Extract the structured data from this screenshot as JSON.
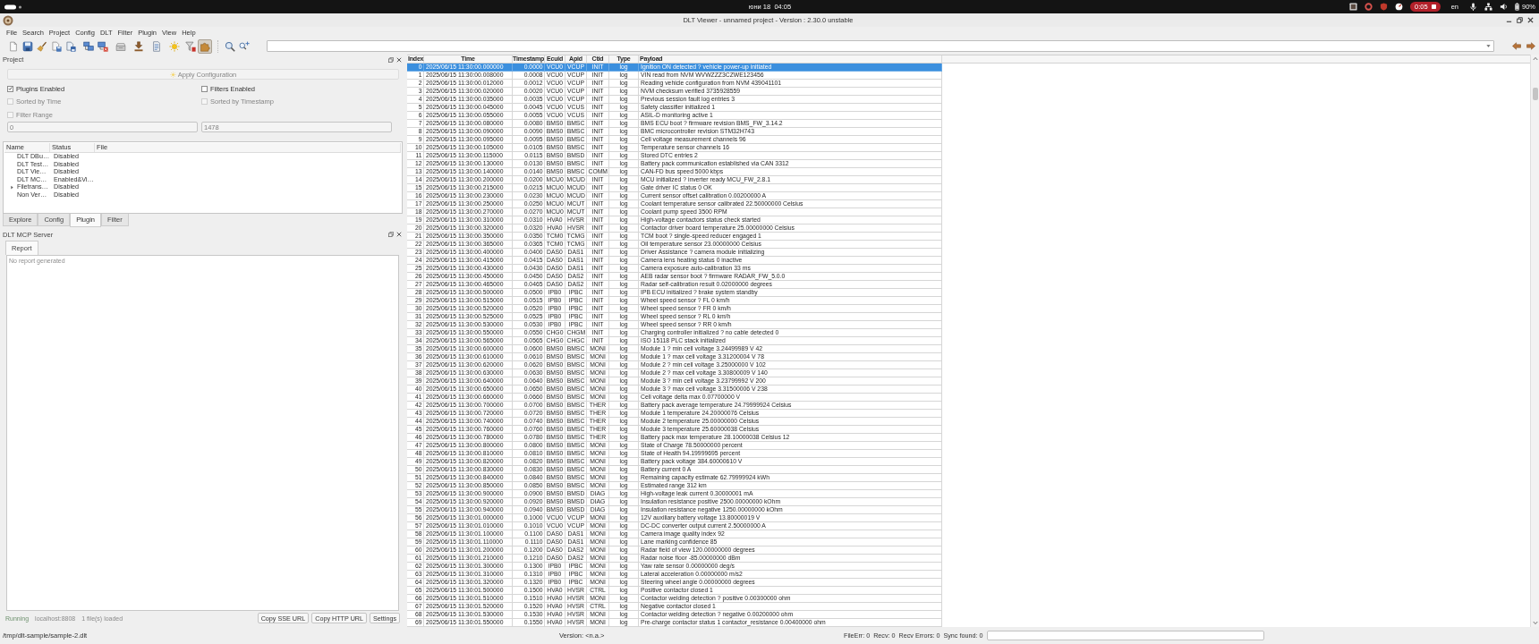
{
  "top_bar": {
    "clock": "юни 18  04:05",
    "recording_time": "0:05",
    "keyboard_layout": "en",
    "battery": "90%"
  },
  "window": {
    "title": "DLT Viewer - unnamed project - Version : 2.30.0 unstable"
  },
  "menu": [
    "File",
    "Search",
    "Project",
    "Config",
    "DLT",
    "Filter",
    "Plugin",
    "View",
    "Help"
  ],
  "toolbar": {
    "buttons": [
      {
        "pressed": false
      },
      {
        "pressed": false
      },
      {
        "pressed": false
      },
      {
        "pressed": false
      },
      {
        "pressed": false
      },
      {
        "pressed": false
      },
      {
        "pressed": false
      },
      {
        "pressed": false
      },
      {
        "pressed": false
      },
      {
        "pressed": false
      },
      {
        "pressed": false
      },
      {
        "pressed": false
      },
      {
        "pressed": true
      },
      {
        "pressed": false
      },
      {
        "pressed": false
      }
    ]
  },
  "project_panel": {
    "title": "Project",
    "apply_button": {
      "label": "Apply Configuration",
      "disabled": true
    },
    "options": [
      {
        "label": "Plugins Enabled",
        "checked": true,
        "disabled": false
      },
      {
        "label": "Filters Enabled",
        "checked": false,
        "disabled": false
      },
      {
        "label": "Sorted by Time",
        "checked": false,
        "disabled": true
      },
      {
        "label": "Sorted by Timestamp",
        "checked": false,
        "disabled": true
      },
      {
        "label": "Filter Range",
        "checked": false,
        "disabled": true
      }
    ],
    "range": [
      {
        "value": "0",
        "disabled": true
      },
      {
        "value": "1478",
        "disabled": true
      }
    ],
    "plugins": {
      "columns": [
        "Name",
        "Status",
        "File"
      ],
      "rows": [
        {
          "name": "DLT DBu…",
          "status": "Disabled",
          "has_children": false
        },
        {
          "name": "DLT Test…",
          "status": "Disabled",
          "has_children": false
        },
        {
          "name": "DLT Vie…",
          "status": "Disabled",
          "has_children": false
        },
        {
          "name": "DLT MC…",
          "status": "Enabled&Vi…",
          "has_children": false
        },
        {
          "name": "Filetrans…",
          "status": "Disabled",
          "has_children": true
        },
        {
          "name": "Non Ver…",
          "status": "Disabled",
          "has_children": false
        }
      ]
    },
    "tabs": [
      {
        "label": "Explore",
        "selected": false
      },
      {
        "label": "Config",
        "selected": false
      },
      {
        "label": "Plugin",
        "selected": true
      },
      {
        "label": "Filter",
        "selected": false
      }
    ]
  },
  "mcp_panel": {
    "title": "DLT MCP Server",
    "tabs": [
      {
        "label": "Report",
        "selected": true
      }
    ],
    "report": {
      "placeholder": "No report generated"
    },
    "state": "Running",
    "address": "localhost:8808",
    "files": "1 file(s) loaded",
    "buttons": [
      "Copy SSE URL",
      "Copy HTTP URL",
      "Settings"
    ]
  },
  "log_table": {
    "columns": [
      "Index",
      "Time",
      "Timestamp",
      "Ecuid",
      "Apid",
      "Ctid",
      "Type",
      "Payload"
    ],
    "rows": [
      {
        "selected": true,
        "cells": [
          "0",
          "2025/06/15 11:30:00.000000",
          "0.0000",
          "VCU0",
          "VCUP",
          "INIT",
          "log",
          "Ignition ON detected ? vehicle power-up initiated"
        ]
      },
      {
        "selected": false,
        "cells": [
          "1",
          "2025/06/15 11:30:00.008000",
          "0.0008",
          "VCU0",
          "VCUP",
          "INIT",
          "log",
          "VIN read from NVM WVWZZZ3CZWE123456"
        ]
      },
      {
        "selected": false,
        "cells": [
          "2",
          "2025/06/15 11:30:00.012000",
          "0.0012",
          "VCU0",
          "VCUP",
          "INIT",
          "log",
          "Reading vehicle configuration from NVM 439041101"
        ]
      },
      {
        "selected": false,
        "cells": [
          "3",
          "2025/06/15 11:30:00.020000",
          "0.0020",
          "VCU0",
          "VCUP",
          "INIT",
          "log",
          "NVM checksum verified 3735928559"
        ]
      },
      {
        "selected": false,
        "cells": [
          "4",
          "2025/06/15 11:30:00.035000",
          "0.0035",
          "VCU0",
          "VCUP",
          "INIT",
          "log",
          "Previous session fault log entries 3"
        ]
      },
      {
        "selected": false,
        "cells": [
          "5",
          "2025/06/15 11:30:00.045000",
          "0.0045",
          "VCU0",
          "VCUS",
          "INIT",
          "log",
          "Safety classifier initialized 1"
        ]
      },
      {
        "selected": false,
        "cells": [
          "6",
          "2025/06/15 11:30:00.055000",
          "0.0055",
          "VCU0",
          "VCUS",
          "INIT",
          "log",
          "ASIL-D monitoring active 1"
        ]
      },
      {
        "selected": false,
        "cells": [
          "7",
          "2025/06/15 11:30:00.080000",
          "0.0080",
          "BMS0",
          "BMSC",
          "INIT",
          "log",
          "BMS ECU boot ? firmware revision BMS_FW_3.14.2"
        ]
      },
      {
        "selected": false,
        "cells": [
          "8",
          "2025/06/15 11:30:00.090000",
          "0.0090",
          "BMS0",
          "BMSC",
          "INIT",
          "log",
          "BMC microcontroller revision STM32H743"
        ]
      },
      {
        "selected": false,
        "cells": [
          "9",
          "2025/06/15 11:30:00.095000",
          "0.0095",
          "BMS0",
          "BMSC",
          "INIT",
          "log",
          "Cell voltage measurement channels 96"
        ]
      },
      {
        "selected": false,
        "cells": [
          "10",
          "2025/06/15 11:30:00.105000",
          "0.0105",
          "BMS0",
          "BMSC",
          "INIT",
          "log",
          "Temperature sensor channels 16"
        ]
      },
      {
        "selected": false,
        "cells": [
          "11",
          "2025/06/15 11:30:00.115000",
          "0.0115",
          "BMS0",
          "BMSD",
          "INIT",
          "log",
          "Stored DTC entries 2"
        ]
      },
      {
        "selected": false,
        "cells": [
          "12",
          "2025/06/15 11:30:00.130000",
          "0.0130",
          "BMS0",
          "BMSC",
          "INIT",
          "log",
          "Battery pack communication established via CAN 3312"
        ]
      },
      {
        "selected": false,
        "cells": [
          "13",
          "2025/06/15 11:30:00.140000",
          "0.0140",
          "BMS0",
          "BMSC",
          "COMM",
          "log",
          "CAN-FD bus speed 5000 kbps"
        ]
      },
      {
        "selected": false,
        "cells": [
          "14",
          "2025/06/15 11:30:00.200000",
          "0.0200",
          "MCU0",
          "MCUD",
          "INIT",
          "log",
          "MCU initialized ? inverter ready MCU_FW_2.8.1"
        ]
      },
      {
        "selected": false,
        "cells": [
          "15",
          "2025/06/15 11:30:00.215000",
          "0.0215",
          "MCU0",
          "MCUD",
          "INIT",
          "log",
          "Gate driver IC status 0 OK"
        ]
      },
      {
        "selected": false,
        "cells": [
          "16",
          "2025/06/15 11:30:00.230000",
          "0.0230",
          "MCU0",
          "MCUD",
          "INIT",
          "log",
          "Current sensor offset calibration 0.00200000 A"
        ]
      },
      {
        "selected": false,
        "cells": [
          "17",
          "2025/06/15 11:30:00.250000",
          "0.0250",
          "MCU0",
          "MCUT",
          "INIT",
          "log",
          "Coolant temperature sensor calibrated 22.50000000 Celsius"
        ]
      },
      {
        "selected": false,
        "cells": [
          "18",
          "2025/06/15 11:30:00.270000",
          "0.0270",
          "MCU0",
          "MCUT",
          "INIT",
          "log",
          "Coolant pump speed 3500 RPM"
        ]
      },
      {
        "selected": false,
        "cells": [
          "19",
          "2025/06/15 11:30:00.310000",
          "0.0310",
          "HVA0",
          "HVSR",
          "INIT",
          "log",
          "High-voltage contactors status check started"
        ]
      },
      {
        "selected": false,
        "cells": [
          "20",
          "2025/06/15 11:30:00.320000",
          "0.0320",
          "HVA0",
          "HVSR",
          "INIT",
          "log",
          "Contactor driver board temperature 25.00000000 Celsius"
        ]
      },
      {
        "selected": false,
        "cells": [
          "21",
          "2025/06/15 11:30:00.350000",
          "0.0350",
          "TCM0",
          "TCMG",
          "INIT",
          "log",
          "TCM boot ? single-speed reducer engaged 1"
        ]
      },
      {
        "selected": false,
        "cells": [
          "22",
          "2025/06/15 11:30:00.365000",
          "0.0365",
          "TCM0",
          "TCMG",
          "INIT",
          "log",
          "Oil temperature sensor 23.00000000 Celsius"
        ]
      },
      {
        "selected": false,
        "cells": [
          "23",
          "2025/06/15 11:30:00.400000",
          "0.0400",
          "DAS0",
          "DAS1",
          "INIT",
          "log",
          "Driver Assistance ? camera module initializing"
        ]
      },
      {
        "selected": false,
        "cells": [
          "24",
          "2025/06/15 11:30:00.415000",
          "0.0415",
          "DAS0",
          "DAS1",
          "INIT",
          "log",
          "Camera lens heating status 0 inactive"
        ]
      },
      {
        "selected": false,
        "cells": [
          "25",
          "2025/06/15 11:30:00.430000",
          "0.0430",
          "DAS0",
          "DAS1",
          "INIT",
          "log",
          "Camera exposure auto-calibration 33 ms"
        ]
      },
      {
        "selected": false,
        "cells": [
          "26",
          "2025/06/15 11:30:00.450000",
          "0.0450",
          "DAS0",
          "DAS2",
          "INIT",
          "log",
          "AEB radar sensor boot ? firmware RADAR_FW_5.0.0"
        ]
      },
      {
        "selected": false,
        "cells": [
          "27",
          "2025/06/15 11:30:00.465000",
          "0.0465",
          "DAS0",
          "DAS2",
          "INIT",
          "log",
          "Radar self-calibration result 0.02000000 degrees"
        ]
      },
      {
        "selected": false,
        "cells": [
          "28",
          "2025/06/15 11:30:00.500000",
          "0.0500",
          "IPB0",
          "IPBC",
          "INIT",
          "log",
          "IPB ECU initialized ? brake system standby"
        ]
      },
      {
        "selected": false,
        "cells": [
          "29",
          "2025/06/15 11:30:00.515000",
          "0.0515",
          "IPB0",
          "IPBC",
          "INIT",
          "log",
          "Wheel speed sensor ? FL 0 km/h"
        ]
      },
      {
        "selected": false,
        "cells": [
          "30",
          "2025/06/15 11:30:00.520000",
          "0.0520",
          "IPB0",
          "IPBC",
          "INIT",
          "log",
          "Wheel speed sensor ? FR 0 km/h"
        ]
      },
      {
        "selected": false,
        "cells": [
          "31",
          "2025/06/15 11:30:00.525000",
          "0.0525",
          "IPB0",
          "IPBC",
          "INIT",
          "log",
          "Wheel speed sensor ? RL 0 km/h"
        ]
      },
      {
        "selected": false,
        "cells": [
          "32",
          "2025/06/15 11:30:00.530000",
          "0.0530",
          "IPB0",
          "IPBC",
          "INIT",
          "log",
          "Wheel speed sensor ? RR 0 km/h"
        ]
      },
      {
        "selected": false,
        "cells": [
          "33",
          "2025/06/15 11:30:00.550000",
          "0.0550",
          "CHG0",
          "CHGM",
          "INIT",
          "log",
          "Charging controller initialized ? no cable detected 0"
        ]
      },
      {
        "selected": false,
        "cells": [
          "34",
          "2025/06/15 11:30:00.565000",
          "0.0565",
          "CHG0",
          "CHGC",
          "INIT",
          "log",
          "ISO 15118 PLC stack initialized"
        ]
      },
      {
        "selected": false,
        "cells": [
          "35",
          "2025/06/15 11:30:00.600000",
          "0.0600",
          "BMS0",
          "BMSC",
          "MONI",
          "log",
          "Module 1 ? min cell voltage 3.24499989 V 42"
        ]
      },
      {
        "selected": false,
        "cells": [
          "36",
          "2025/06/15 11:30:00.610000",
          "0.0610",
          "BMS0",
          "BMSC",
          "MONI",
          "log",
          "Module 1 ? max cell voltage 3.31200004 V 78"
        ]
      },
      {
        "selected": false,
        "cells": [
          "37",
          "2025/06/15 11:30:00.620000",
          "0.0620",
          "BMS0",
          "BMSC",
          "MONI",
          "log",
          "Module 2 ? min cell voltage 3.25000000 V 102"
        ]
      },
      {
        "selected": false,
        "cells": [
          "38",
          "2025/06/15 11:30:00.630000",
          "0.0630",
          "BMS0",
          "BMSC",
          "MONI",
          "log",
          "Module 2 ? max cell voltage 3.30800009 V 140"
        ]
      },
      {
        "selected": false,
        "cells": [
          "39",
          "2025/06/15 11:30:00.640000",
          "0.0640",
          "BMS0",
          "BMSC",
          "MONI",
          "log",
          "Module 3 ? min cell voltage 3.23799992 V 200"
        ]
      },
      {
        "selected": false,
        "cells": [
          "40",
          "2025/06/15 11:30:00.650000",
          "0.0650",
          "BMS0",
          "BMSC",
          "MONI",
          "log",
          "Module 3 ? max cell voltage 3.31500006 V 238"
        ]
      },
      {
        "selected": false,
        "cells": [
          "41",
          "2025/06/15 11:30:00.660000",
          "0.0660",
          "BMS0",
          "BMSC",
          "MONI",
          "log",
          "Cell voltage delta max 0.07700000 V"
        ]
      },
      {
        "selected": false,
        "cells": [
          "42",
          "2025/06/15 11:30:00.700000",
          "0.0700",
          "BMS0",
          "BMSC",
          "THER",
          "log",
          "Battery pack average temperature 24.79999924 Celsius"
        ]
      },
      {
        "selected": false,
        "cells": [
          "43",
          "2025/06/15 11:30:00.720000",
          "0.0720",
          "BMS0",
          "BMSC",
          "THER",
          "log",
          "Module 1 temperature 24.20000076 Celsius"
        ]
      },
      {
        "selected": false,
        "cells": [
          "44",
          "2025/06/15 11:30:00.740000",
          "0.0740",
          "BMS0",
          "BMSC",
          "THER",
          "log",
          "Module 2 temperature 25.00000000 Celsius"
        ]
      },
      {
        "selected": false,
        "cells": [
          "45",
          "2025/06/15 11:30:00.760000",
          "0.0760",
          "BMS0",
          "BMSC",
          "THER",
          "log",
          "Module 3 temperature 25.60000038 Celsius"
        ]
      },
      {
        "selected": false,
        "cells": [
          "46",
          "2025/06/15 11:30:00.780000",
          "0.0780",
          "BMS0",
          "BMSC",
          "THER",
          "log",
          "Battery pack max temperature 28.10000038 Celsius 12"
        ]
      },
      {
        "selected": false,
        "cells": [
          "47",
          "2025/06/15 11:30:00.800000",
          "0.0800",
          "BMS0",
          "BMSC",
          "MONI",
          "log",
          "State of Charge 78.50000000 percent"
        ]
      },
      {
        "selected": false,
        "cells": [
          "48",
          "2025/06/15 11:30:00.810000",
          "0.0810",
          "BMS0",
          "BMSC",
          "MONI",
          "log",
          "State of Health 94.19999695 percent"
        ]
      },
      {
        "selected": false,
        "cells": [
          "49",
          "2025/06/15 11:30:00.820000",
          "0.0820",
          "BMS0",
          "BMSC",
          "MONI",
          "log",
          "Battery pack voltage 384.60000610 V"
        ]
      },
      {
        "selected": false,
        "cells": [
          "50",
          "2025/06/15 11:30:00.830000",
          "0.0830",
          "BMS0",
          "BMSC",
          "MONI",
          "log",
          "Battery current 0 A"
        ]
      },
      {
        "selected": false,
        "cells": [
          "51",
          "2025/06/15 11:30:00.840000",
          "0.0840",
          "BMS0",
          "BMSC",
          "MONI",
          "log",
          "Remaining capacity estimate 62.79999924 kWh"
        ]
      },
      {
        "selected": false,
        "cells": [
          "52",
          "2025/06/15 11:30:00.850000",
          "0.0850",
          "BMS0",
          "BMSC",
          "MONI",
          "log",
          "Estimated range 312 km"
        ]
      },
      {
        "selected": false,
        "cells": [
          "53",
          "2025/06/15 11:30:00.900000",
          "0.0900",
          "BMS0",
          "BMSD",
          "DIAG",
          "log",
          "High-voltage leak current 0.30000001 mA"
        ]
      },
      {
        "selected": false,
        "cells": [
          "54",
          "2025/06/15 11:30:00.920000",
          "0.0920",
          "BMS0",
          "BMSD",
          "DIAG",
          "log",
          "Insulation resistance positive 2500.00000000 kOhm"
        ]
      },
      {
        "selected": false,
        "cells": [
          "55",
          "2025/06/15 11:30:00.940000",
          "0.0940",
          "BMS0",
          "BMSD",
          "DIAG",
          "log",
          "Insulation resistance negative 1250.00000000 kOhm"
        ]
      },
      {
        "selected": false,
        "cells": [
          "56",
          "2025/06/15 11:30:01.000000",
          "0.1000",
          "VCU0",
          "VCUP",
          "MONI",
          "log",
          "12V auxiliary battery voltage 13.80000019 V"
        ]
      },
      {
        "selected": false,
        "cells": [
          "57",
          "2025/06/15 11:30:01.010000",
          "0.1010",
          "VCU0",
          "VCUP",
          "MONI",
          "log",
          "DC-DC converter output current 2.50000000 A"
        ]
      },
      {
        "selected": false,
        "cells": [
          "58",
          "2025/06/15 11:30:01.100000",
          "0.1100",
          "DAS0",
          "DAS1",
          "MONI",
          "log",
          "Camera image quality index 92"
        ]
      },
      {
        "selected": false,
        "cells": [
          "59",
          "2025/06/15 11:30:01.110000",
          "0.1110",
          "DAS0",
          "DAS1",
          "MONI",
          "log",
          "Lane marking confidence 85"
        ]
      },
      {
        "selected": false,
        "cells": [
          "60",
          "2025/06/15 11:30:01.200000",
          "0.1200",
          "DAS0",
          "DAS2",
          "MONI",
          "log",
          "Radar field of view 120.00000000 degrees"
        ]
      },
      {
        "selected": false,
        "cells": [
          "61",
          "2025/06/15 11:30:01.210000",
          "0.1210",
          "DAS0",
          "DAS2",
          "MONI",
          "log",
          "Radar noise floor -85.00000000 dBm"
        ]
      },
      {
        "selected": false,
        "cells": [
          "62",
          "2025/06/15 11:30:01.300000",
          "0.1300",
          "IPB0",
          "IPBC",
          "MONI",
          "log",
          "Yaw rate sensor 0.00000000 deg/s"
        ]
      },
      {
        "selected": false,
        "cells": [
          "63",
          "2025/06/15 11:30:01.310000",
          "0.1310",
          "IPB0",
          "IPBC",
          "MONI",
          "log",
          "Lateral acceleration 0.00000000 m/s2"
        ]
      },
      {
        "selected": false,
        "cells": [
          "64",
          "2025/06/15 11:30:01.320000",
          "0.1320",
          "IPB0",
          "IPBC",
          "MONI",
          "log",
          "Steering wheel angle 0.00000000 degrees"
        ]
      },
      {
        "selected": false,
        "cells": [
          "65",
          "2025/06/15 11:30:01.500000",
          "0.1500",
          "HVA0",
          "HVSR",
          "CTRL",
          "log",
          "Positive contactor closed 1"
        ]
      },
      {
        "selected": false,
        "cells": [
          "66",
          "2025/06/15 11:30:01.510000",
          "0.1510",
          "HVA0",
          "HVSR",
          "MONI",
          "log",
          "Contactor welding detection ? positive 0.00300000 ohm"
        ]
      },
      {
        "selected": false,
        "cells": [
          "67",
          "2025/06/15 11:30:01.520000",
          "0.1520",
          "HVA0",
          "HVSR",
          "CTRL",
          "log",
          "Negative contactor closed 1"
        ]
      },
      {
        "selected": false,
        "cells": [
          "68",
          "2025/06/15 11:30:01.530000",
          "0.1530",
          "HVA0",
          "HVSR",
          "MONI",
          "log",
          "Contactor welding detection ? negative 0.00200000 ohm"
        ]
      },
      {
        "selected": false,
        "cells": [
          "69",
          "2025/06/15 11:30:01.550000",
          "0.1550",
          "HVA0",
          "HVSR",
          "MONI",
          "log",
          "Pre-charge contactor status 1 contactor_resistance 0.00400000 ohm"
        ]
      }
    ]
  },
  "status_bar": {
    "file": "/tmp/dlt-sample/sample-2.dlt",
    "version": "Version: <n.a.>",
    "counters": [
      "FileErr: 0",
      "Recv: 0",
      "Recv Errors: 0",
      "Sync found: 0"
    ]
  }
}
